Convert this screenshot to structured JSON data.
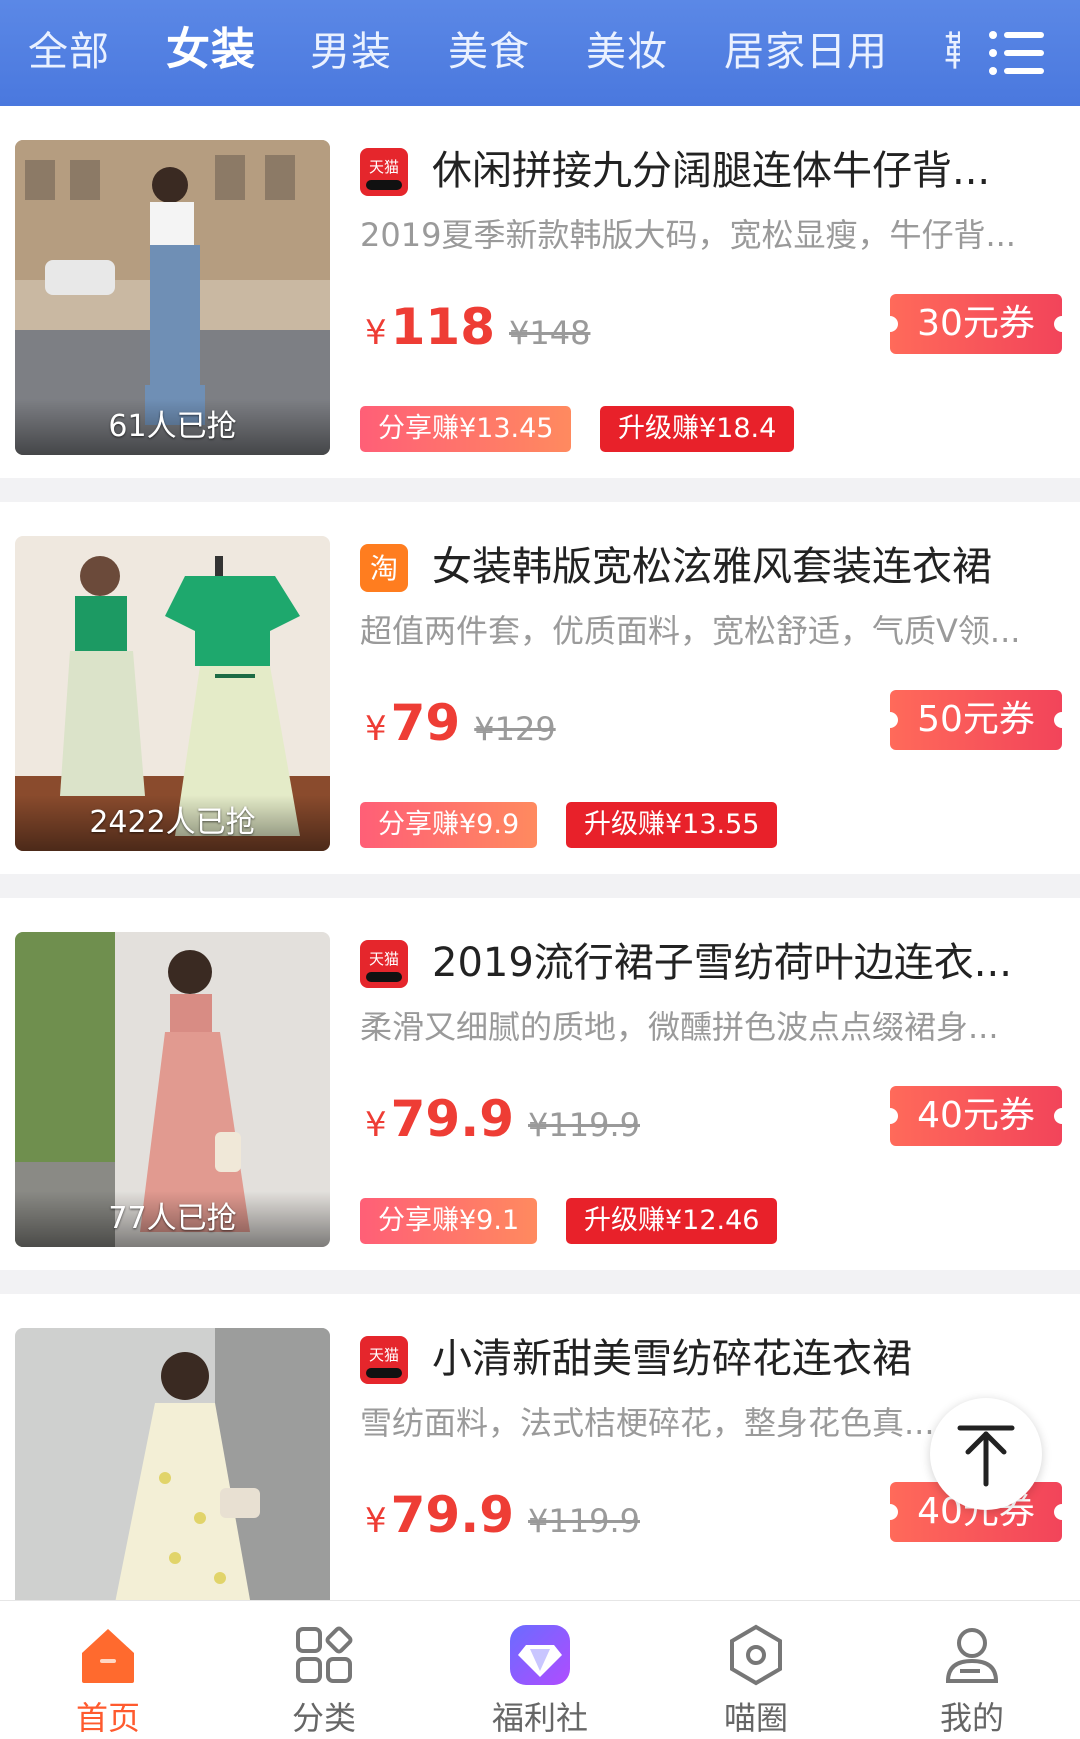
{
  "topbar": {
    "tabs": [
      {
        "label": "全部"
      },
      {
        "label": "女装"
      },
      {
        "label": "男装"
      },
      {
        "label": "美食"
      },
      {
        "label": "美妆"
      },
      {
        "label": "居家日用"
      },
      {
        "label": "鞋"
      }
    ],
    "active_tab": "女装",
    "menu_icon": "menu-list-icon"
  },
  "products": [
    {
      "platform": "天猫",
      "title": "休闲拼接九分阔腿连体牛仔背...",
      "desc": "2019夏季新款韩版大码，宽松显瘦，牛仔背...",
      "yen": "¥",
      "price": "118",
      "original_price": "¥148",
      "coupon": "30元券",
      "sold": "61人已抢",
      "share_earn": "分享赚¥13.45",
      "upgrade_earn": "升级赚¥18.4"
    },
    {
      "platform": "淘",
      "title": "女装韩版宽松泫雅风套装连衣裙",
      "desc": "超值两件套，优质面料，宽松舒适，气质V领...",
      "yen": "¥",
      "price": "79",
      "original_price": "¥129",
      "coupon": "50元券",
      "sold": "2422人已抢",
      "share_earn": "分享赚¥9.9",
      "upgrade_earn": "升级赚¥13.55"
    },
    {
      "platform": "天猫",
      "title": "2019流行裙子雪纺荷叶边连衣...",
      "desc": "柔滑又细腻的质地，微醺拼色波点点缀裙身...",
      "yen": "¥",
      "price": "79.9",
      "original_price": "¥119.9",
      "coupon": "40元券",
      "sold": "77人已抢",
      "share_earn": "分享赚¥9.1",
      "upgrade_earn": "升级赚¥12.46"
    },
    {
      "platform": "天猫",
      "title": "小清新甜美雪纺碎花连衣裙",
      "desc": "雪纺面料，法式桔梗碎花，整身花色真...",
      "yen": "¥",
      "price": "79.9",
      "original_price": "¥119.9",
      "coupon": "40元券",
      "sold": "",
      "share_earn": "",
      "upgrade_earn": ""
    }
  ],
  "back_to_top_icon": "arrow-up-icon",
  "bottom_nav": [
    {
      "label": "首页",
      "icon": "home-icon",
      "active": true
    },
    {
      "label": "分类",
      "icon": "category-grid-icon",
      "active": false
    },
    {
      "label": "福利社",
      "icon": "diamond-vip-icon",
      "active": false
    },
    {
      "label": "喵圈",
      "icon": "hexagon-circle-icon",
      "active": false
    },
    {
      "label": "我的",
      "icon": "user-profile-icon",
      "active": false
    }
  ],
  "colors": {
    "topbar": "#4a78de",
    "price": "#ee3d35",
    "coupon": "#f2445a",
    "upgrade_badge": "#e8212a",
    "nav_active": "#ff5a2e"
  }
}
